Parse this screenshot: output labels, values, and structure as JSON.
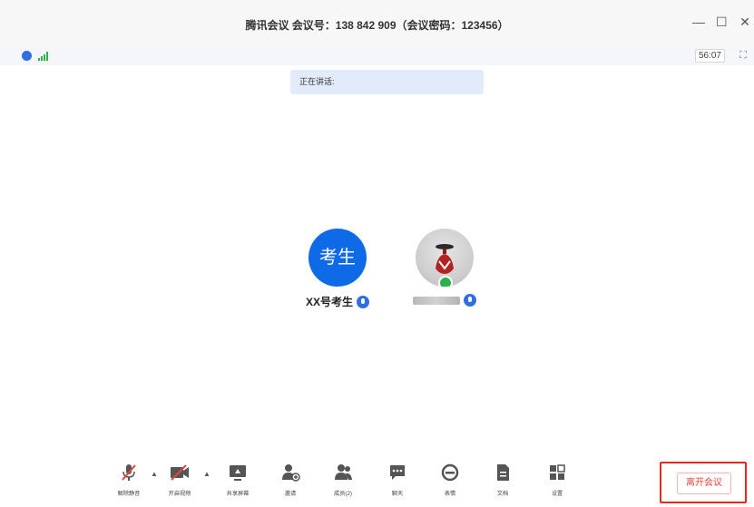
{
  "window": {
    "title": "腾讯会议 会议号：138 842 909（会议密码：123456）",
    "controls": {
      "minimize": "—",
      "maximize": "☐",
      "close": "✕"
    }
  },
  "status": {
    "timer": "56:07",
    "fullscreen_icon": "⛶"
  },
  "speaking_label": "正在讲话:",
  "participants": [
    {
      "avatar_text": "考生",
      "name": "XX号考生"
    },
    {
      "avatar_text": "",
      "name": ""
    }
  ],
  "toolbar": {
    "unmute": "解除静音",
    "start_video": "开启视频",
    "share_screen": "共享屏幕",
    "invite": "邀请",
    "members": "成员(2)",
    "chat": "聊天",
    "reaction": "表情",
    "docs": "文档",
    "settings": "设置",
    "leave": "离开会议"
  },
  "colors": {
    "accent": "#0e6ae6",
    "leave": "#e3453a",
    "highlight_border": "#e8271b",
    "signal": "#2bb24c"
  },
  "icons": [
    "shield-icon",
    "signal-icon",
    "fullscreen-icon",
    "mic-muted-icon",
    "video-off-icon",
    "share-screen-icon",
    "invite-icon",
    "members-icon",
    "chat-icon",
    "emoji-icon",
    "document-icon",
    "settings-icon"
  ]
}
